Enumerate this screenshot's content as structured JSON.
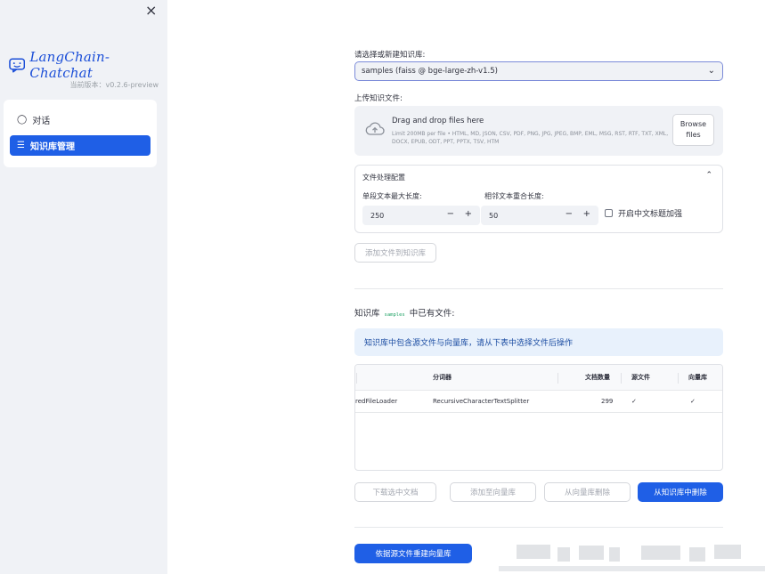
{
  "sidebar": {
    "close_symbol": "×",
    "logo_text": "LangChain-Chatchat",
    "version": "当前版本：v0.2.6-preview",
    "menu": [
      {
        "label": "对话",
        "icon": "chat-bubble-icon"
      },
      {
        "label": "知识库管理",
        "icon": "hamburger-icon"
      }
    ]
  },
  "main": {
    "select_label": "请选择或新建知识库:",
    "selected_kb": "samples (faiss @ bge-large-zh-v1.5)",
    "upload_label": "上传知识文件:",
    "upload": {
      "title": "Drag and drop files here",
      "limit": "Limit 200MB per file • HTML, MD, JSON, CSV, PDF, PNG, JPG, JPEG, BMP, EML, MSG, RST, RTF, TXT, XML, DOCX, EPUB, ODT, PPT, PPTX, TSV, HTM",
      "browse_line1": "Browse",
      "browse_line2": "files"
    },
    "config": {
      "title": "文件处理配置",
      "max_len_label": "单段文本最大长度:",
      "max_len_value": "250",
      "overlap_label": "相邻文本重合长度:",
      "overlap_value": "50",
      "minus": "−",
      "plus": "+",
      "zh_title_label": "开启中文标题加强"
    },
    "add_to_kb_button": "添加文件到知识库",
    "kb_heading_prefix": "知识库",
    "kb_name_code": "samples",
    "kb_heading_suffix": "中已有文件:",
    "info_text": "知识库中包含源文件与向量库，请从下表中选择文件后操作",
    "table": {
      "headers": [
        "",
        "分词器",
        "文档数量",
        "源文件",
        "向量库"
      ],
      "rows": [
        [
          "redFileLoader",
          "RecursiveCharacterTextSplitter",
          "299",
          "✓",
          "✓"
        ]
      ]
    },
    "actions": {
      "download": "下载选中文档",
      "add_vector": "添加至向量库",
      "delete_vector": "从向量库删除",
      "delete_kb": "从知识库中删除"
    },
    "rebuild_button": "依据源文件重建向量库"
  },
  "colors": {
    "primary": "#1f5fe6",
    "sidebar_bg": "#f0f2f6",
    "info_bg": "#e8f1fc"
  }
}
